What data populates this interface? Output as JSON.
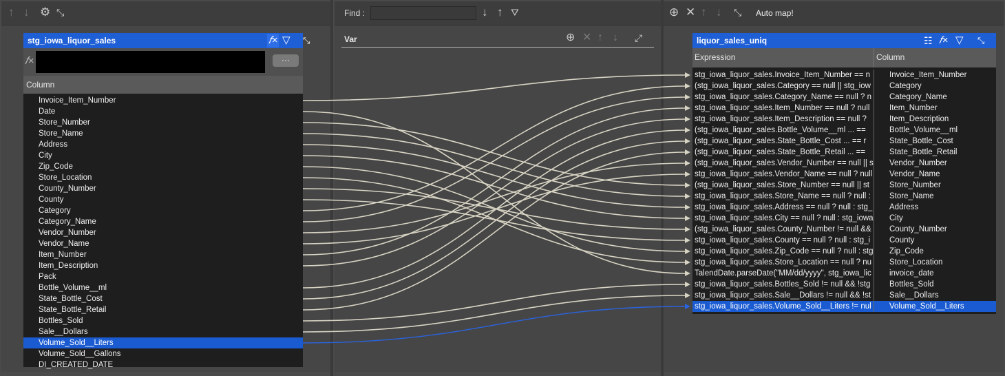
{
  "left": {
    "table_title": "stg_iowa_liquor_sales",
    "expr_button": "···",
    "column_header": "Column",
    "columns": [
      "Invoice_Item_Number",
      "Date",
      "Store_Number",
      "Store_Name",
      "Address",
      "City",
      "Zip_Code",
      "Store_Location",
      "County_Number",
      "County",
      "Category",
      "Category_Name",
      "Vendor_Number",
      "Vendor_Name",
      "Item_Number",
      "Item_Description",
      "Pack",
      "Bottle_Volume__ml",
      "State_Bottle_Cost",
      "State_Bottle_Retail",
      "Bottles_Sold",
      "Sale__Dollars",
      "Volume_Sold__Liters",
      "Volume_Sold__Gallons",
      "DI_CREATED_DATE"
    ],
    "selected_index": 22
  },
  "middle": {
    "find_label": "Find :",
    "find_value": "",
    "var_title": "Var"
  },
  "right": {
    "auto_map_label": "Auto map!",
    "table_title": "liquor_sales_uniq",
    "expression_header": "Expression",
    "column_header": "Column",
    "rows": [
      {
        "expr": "stg_iowa_liquor_sales.Invoice_Item_Number == n",
        "col": "Invoice_Item_Number"
      },
      {
        "expr": "(stg_iowa_liquor_sales.Category  == null || stg_iow",
        "col": "Category"
      },
      {
        "expr": "stg_iowa_liquor_sales.Category_Name == null ? n",
        "col": "Category_Name"
      },
      {
        "expr": "stg_iowa_liquor_sales.Item_Number == null ? null",
        "col": "Item_Number"
      },
      {
        "expr": "stg_iowa_liquor_sales.Item_Description == null ?",
        "col": "Item_Description"
      },
      {
        "expr": "(stg_iowa_liquor_sales.Bottle_Volume__ml  ...  ==",
        "col": "Bottle_Volume__ml"
      },
      {
        "expr": "(stg_iowa_liquor_sales.State_Bottle_Cost  ...  == r",
        "col": "State_Bottle_Cost"
      },
      {
        "expr": "(stg_iowa_liquor_sales.State_Bottle_Retail  ...  ==",
        "col": "State_Bottle_Retail"
      },
      {
        "expr": "(stg_iowa_liquor_sales.Vendor_Number == null || s",
        "col": "Vendor_Number"
      },
      {
        "expr": "stg_iowa_liquor_sales.Vendor_Name == null ? null",
        "col": "Vendor_Name"
      },
      {
        "expr": "(stg_iowa_liquor_sales.Store_Number  == null || st",
        "col": "Store_Number"
      },
      {
        "expr": "stg_iowa_liquor_sales.Store_Name == null ? null :",
        "col": "Store_Name"
      },
      {
        "expr": "stg_iowa_liquor_sales.Address == null ? null : stg_",
        "col": "Address"
      },
      {
        "expr": "stg_iowa_liquor_sales.City == null ? null : stg_iowa",
        "col": "City"
      },
      {
        "expr": "(stg_iowa_liquor_sales.County_Number != null &&",
        "col": "County_Number"
      },
      {
        "expr": "stg_iowa_liquor_sales.County == null ? null : stg_i",
        "col": "County"
      },
      {
        "expr": "stg_iowa_liquor_sales.Zip_Code == null ? null : stg",
        "col": "Zip_Code"
      },
      {
        "expr": "stg_iowa_liquor_sales.Store_Location == null ? nu",
        "col": "Store_Location"
      },
      {
        "expr": "TalendDate.parseDate(\"MM/dd/yyyy\", stg_iowa_lic",
        "col": "invoice_date"
      },
      {
        "expr": "stg_iowa_liquor_sales.Bottles_Sold != null && !stg",
        "col": "Bottles_Sold"
      },
      {
        "expr": "stg_iowa_liquor_sales.Sale__Dollars != null && !st",
        "col": "Sale__Dollars"
      },
      {
        "expr": "stg_iowa_liquor_sales.Volume_Sold__Liters != nul",
        "col": "Volume_Sold__Liters"
      }
    ],
    "selected_index": 21
  },
  "mappings": [
    [
      0,
      0
    ],
    [
      10,
      1
    ],
    [
      11,
      2
    ],
    [
      14,
      3
    ],
    [
      15,
      4
    ],
    [
      17,
      5
    ],
    [
      18,
      6
    ],
    [
      19,
      7
    ],
    [
      12,
      8
    ],
    [
      13,
      9
    ],
    [
      2,
      10
    ],
    [
      3,
      11
    ],
    [
      4,
      12
    ],
    [
      5,
      13
    ],
    [
      8,
      14
    ],
    [
      9,
      15
    ],
    [
      6,
      16
    ],
    [
      7,
      17
    ],
    [
      1,
      18
    ],
    [
      20,
      19
    ],
    [
      21,
      20
    ],
    [
      22,
      21
    ]
  ],
  "colors": {
    "link": "#d8d4c4",
    "link_selected": "#2a63e0",
    "header_blue": "#1f5fd6"
  }
}
